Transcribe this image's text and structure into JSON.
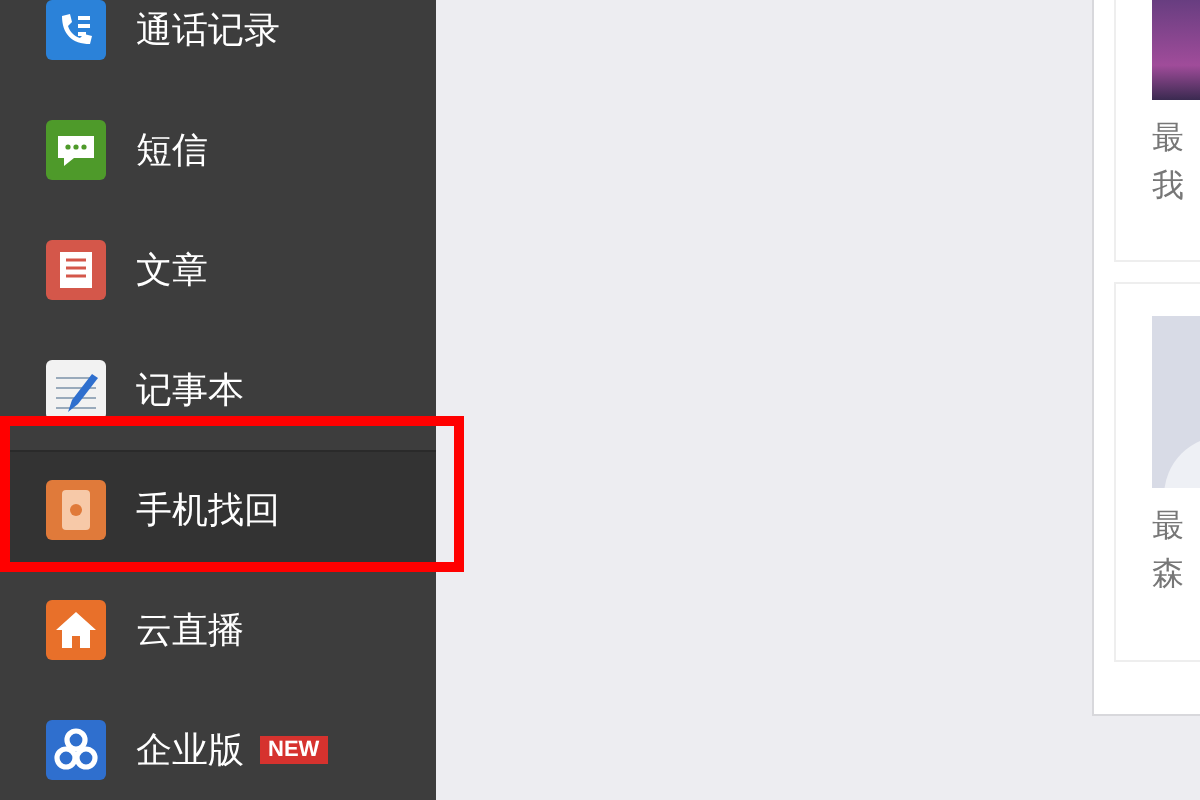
{
  "sidebar": {
    "items": [
      {
        "kind": "calls",
        "label": "通话记录",
        "selected": false,
        "highlighted": false
      },
      {
        "kind": "messages",
        "label": "短信",
        "selected": false,
        "highlighted": false
      },
      {
        "kind": "articles",
        "label": "文章",
        "selected": false,
        "highlighted": false
      },
      {
        "kind": "notes",
        "label": "记事本",
        "selected": false,
        "highlighted": false
      },
      {
        "kind": "phone",
        "label": "手机找回",
        "selected": true,
        "highlighted": true
      },
      {
        "kind": "home",
        "label": "云直播",
        "selected": false,
        "highlighted": false
      },
      {
        "kind": "enterprise",
        "label": "企业版",
        "badge": "NEW",
        "selected": false,
        "highlighted": false
      }
    ]
  },
  "cards": [
    {
      "kind": "photo",
      "lines": [
        "最",
        "我"
      ]
    },
    {
      "kind": "avatar",
      "lines": [
        "最",
        "森"
      ]
    }
  ]
}
